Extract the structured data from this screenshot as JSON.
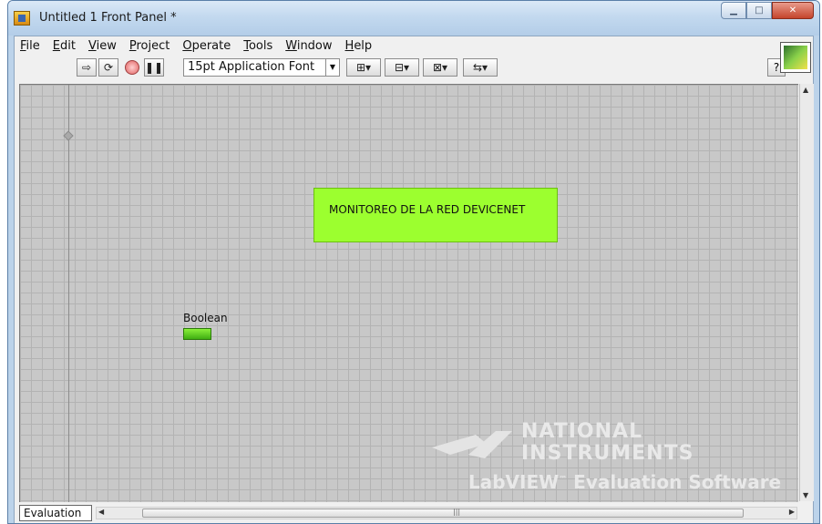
{
  "window": {
    "title": "Untitled 1 Front Panel *"
  },
  "menu": [
    "File",
    "Edit",
    "View",
    "Project",
    "Operate",
    "Tools",
    "Window",
    "Help"
  ],
  "toolbar": {
    "run_icon": "run-arrow-icon",
    "run_continuous_icon": "run-continuously-icon",
    "abort_icon": "abort-icon",
    "pause_icon": "pause-icon",
    "font_selector": "15pt Application Font",
    "align_icon": "align-objects-icon",
    "distribute_icon": "distribute-objects-icon",
    "resize_icon": "resize-objects-icon",
    "reorder_icon": "reorder-icon",
    "help_icon": "context-help-icon"
  },
  "panel": {
    "banner_text": "MONITOREO DE LA RED DEVICENET",
    "banner_color": "#9cff2f",
    "boolean_label": "Boolean",
    "boolean_state": true,
    "boolean_color": "#5ccc1f"
  },
  "watermark": {
    "line1": "NATIONAL",
    "line2": "INSTRUMENTS",
    "line3_a": "LabVIEW",
    "line3_tm": "™",
    "line3_b": "Evaluation Software"
  },
  "status": {
    "tab_label": "Evaluation"
  }
}
